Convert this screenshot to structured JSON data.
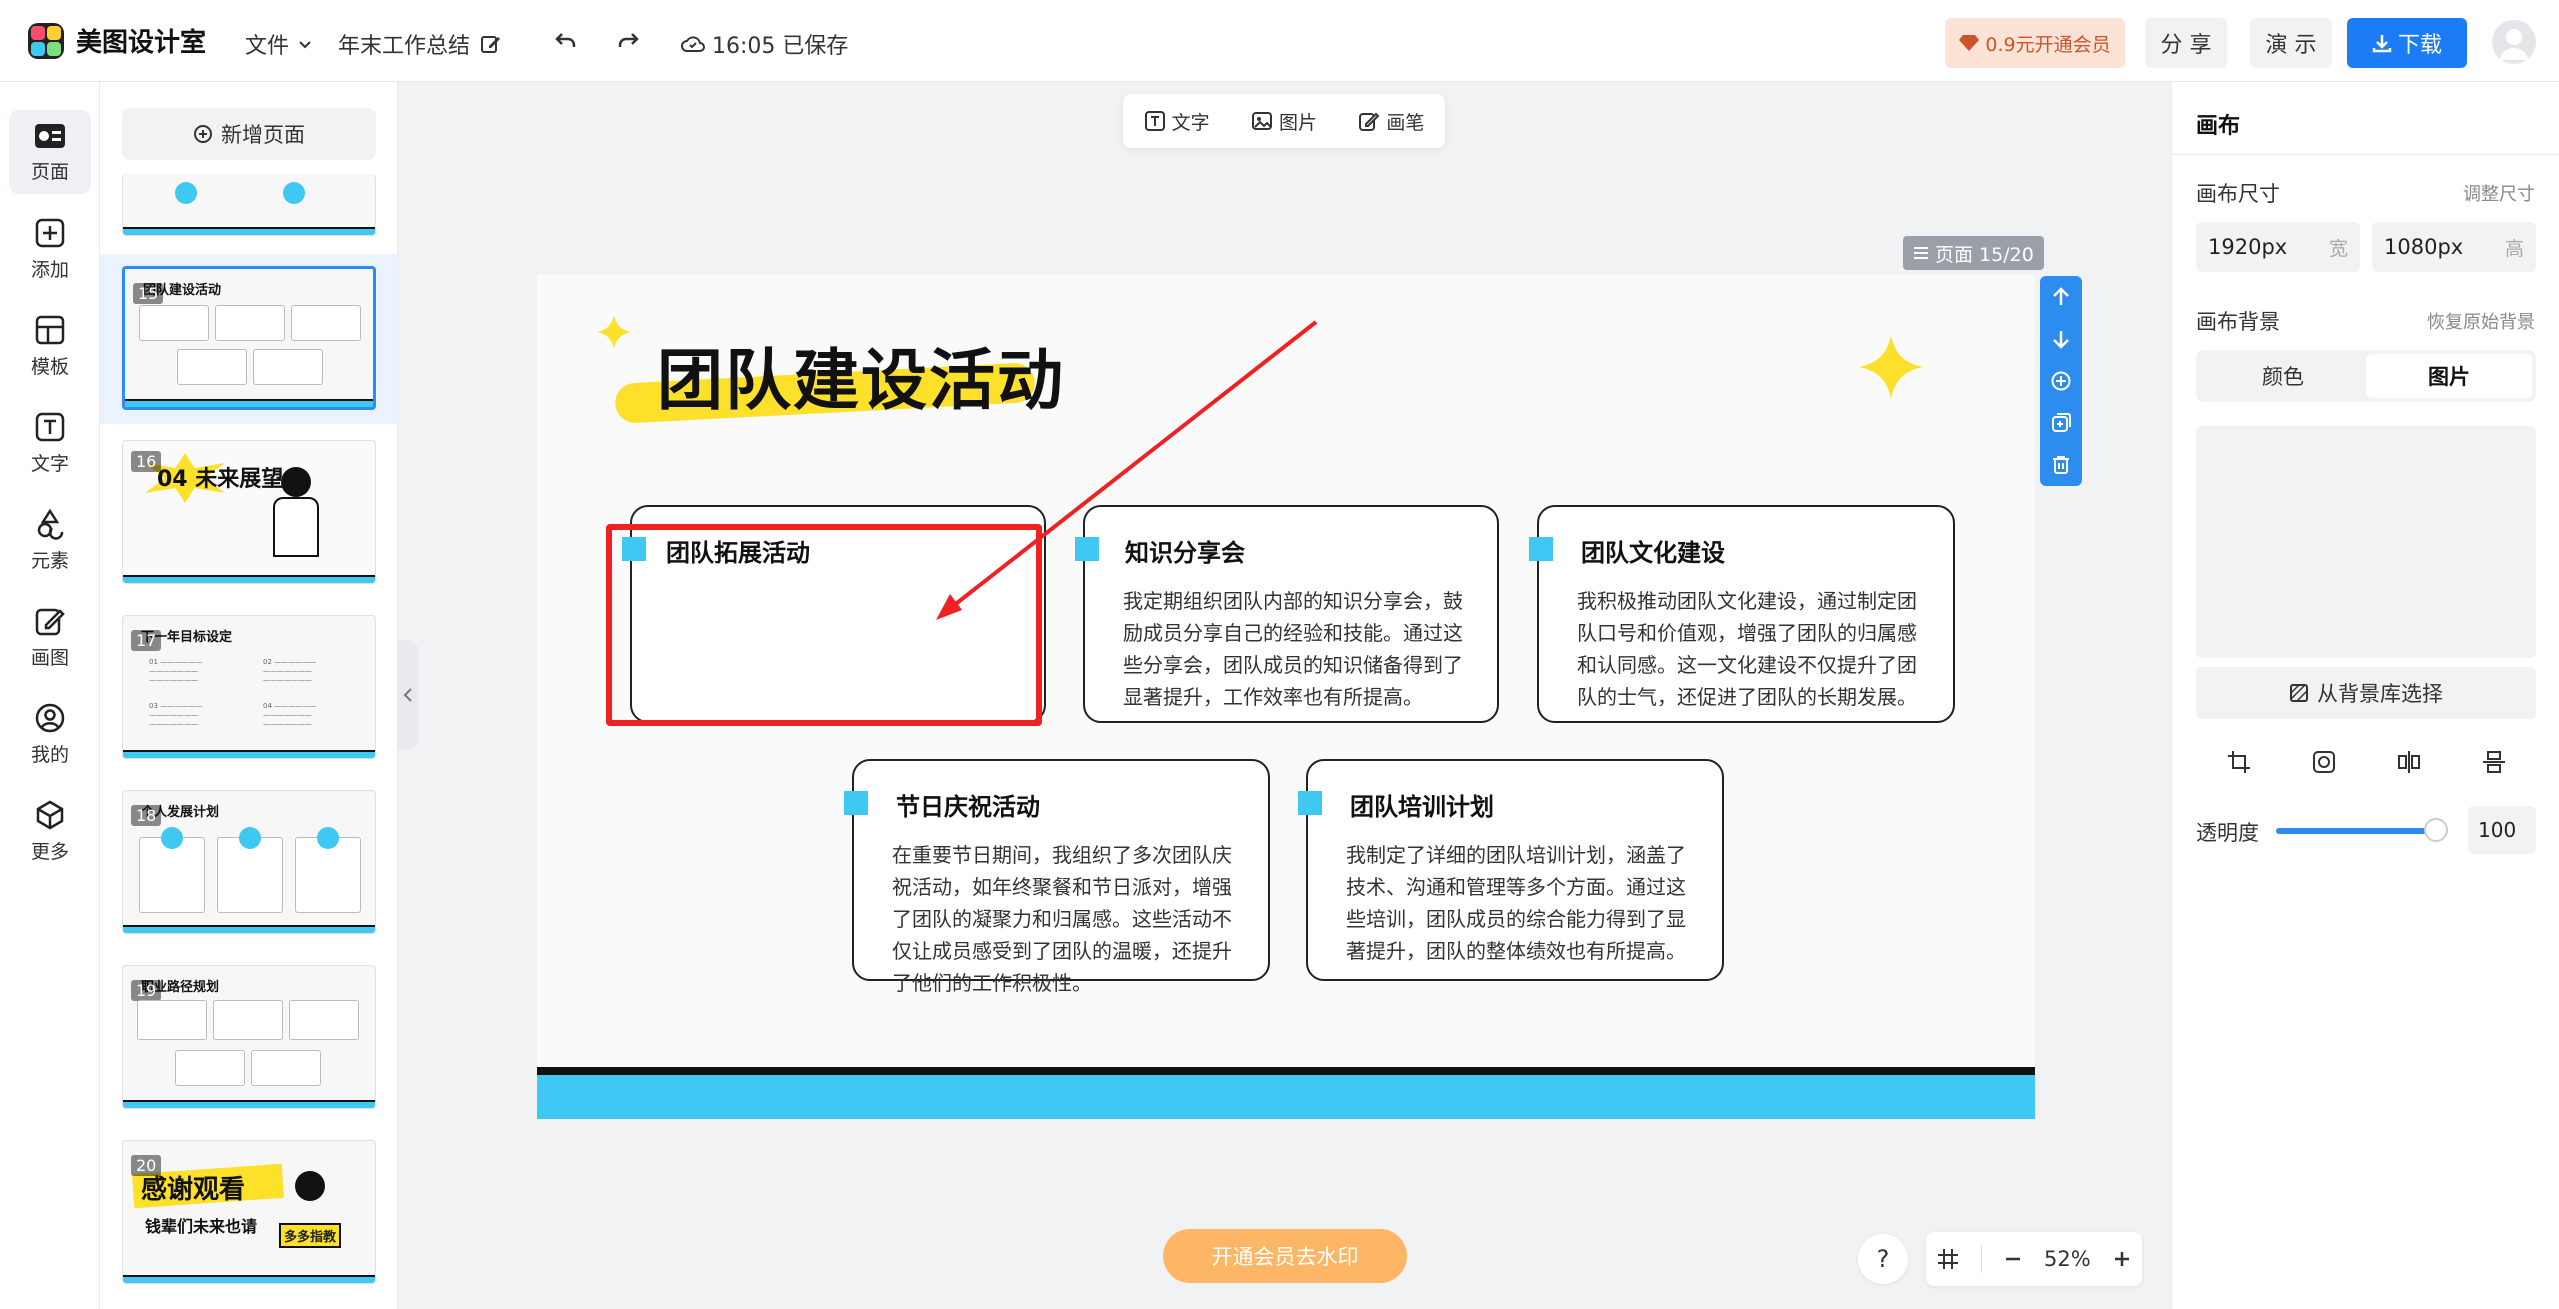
{
  "app": {
    "name": "美图设计室",
    "menu_file": "文件",
    "doc_title": "年末工作总结",
    "save_status": "16:05 已保存"
  },
  "header": {
    "vip_label": "0.9元开通会员",
    "share_label": "分 享",
    "present_label": "演 示",
    "download_label": "下载"
  },
  "left_tools": [
    {
      "label": "页面",
      "icon": "pages-icon"
    },
    {
      "label": "添加",
      "icon": "plus-square-icon"
    },
    {
      "label": "模板",
      "icon": "template-icon"
    },
    {
      "label": "文字",
      "icon": "text-icon"
    },
    {
      "label": "元素",
      "icon": "shapes-icon"
    },
    {
      "label": "画图",
      "icon": "draw-icon"
    },
    {
      "label": "我的",
      "icon": "user-icon"
    },
    {
      "label": "更多",
      "icon": "cube-icon"
    }
  ],
  "pages_panel": {
    "add_page_label": "新增页面",
    "thumbnails": [
      {
        "num": "15",
        "title": "团队建设活动"
      },
      {
        "num": "16",
        "title": "04 未来展望"
      },
      {
        "num": "17",
        "title": "下一年目标设定"
      },
      {
        "num": "18",
        "title": "个人发展计划"
      },
      {
        "num": "19",
        "title": "职业路径规划"
      },
      {
        "num": "20",
        "title": "感谢观看",
        "subtitle": "钱辈们未来也请",
        "badge": "多多指教"
      }
    ]
  },
  "floatbar": {
    "text_label": "文字",
    "image_label": "图片",
    "pen_label": "画笔"
  },
  "canvas": {
    "page_indicator": "页面 15/20",
    "title": "团队建设活动",
    "cards": [
      {
        "title": "团队拓展活动",
        "body": ""
      },
      {
        "title": "知识分享会",
        "body": "我定期组织团队内部的知识分享会，鼓励成员分享自己的经验和技能。通过这些分享会，团队成员的知识储备得到了显著提升，工作效率也有所提高。"
      },
      {
        "title": "团队文化建设",
        "body": "我积极推动团队文化建设，通过制定团队口号和价值观，增强了团队的归属感和认同感。这一文化建设不仅提升了团队的士气，还促进了团队的长期发展。"
      },
      {
        "title": "节日庆祝活动",
        "body": "在重要节日期间，我组织了多次团队庆祝活动，如年终聚餐和节日派对，增强了团队的凝聚力和归属感。这些活动不仅让成员感受到了团队的温暖，还提升了他们的工作积极性。"
      },
      {
        "title": "团队培训计划",
        "body": "我制定了详细的团队培训计划，涵盖了技术、沟通和管理等多个方面。通过这些培训，团队成员的综合能力得到了显著提升，团队的整体绩效也有所提高。"
      }
    ]
  },
  "bottom": {
    "watermark_label": "开通会员去水印",
    "help_label": "?",
    "zoom_level": "52%"
  },
  "right_panel": {
    "title": "画布",
    "size_label": "画布尺寸",
    "resize_link": "调整尺寸",
    "width_value": "1920px",
    "width_unit": "宽",
    "height_value": "1080px",
    "height_unit": "高",
    "bg_label": "画布背景",
    "reset_bg_link": "恢复原始背景",
    "tab_color": "颜色",
    "tab_image": "图片",
    "bg_library_label": "从背景库选择",
    "opacity_label": "透明度",
    "opacity_value": "100"
  },
  "colors": {
    "accent": "#2d8cf0",
    "download_blue": "#1b7cf5",
    "slide_cyan": "#3ec8f2",
    "title_yellow": "#fde02a",
    "annotation_red": "#ee2222",
    "watermark_orange": "#fdb665"
  }
}
